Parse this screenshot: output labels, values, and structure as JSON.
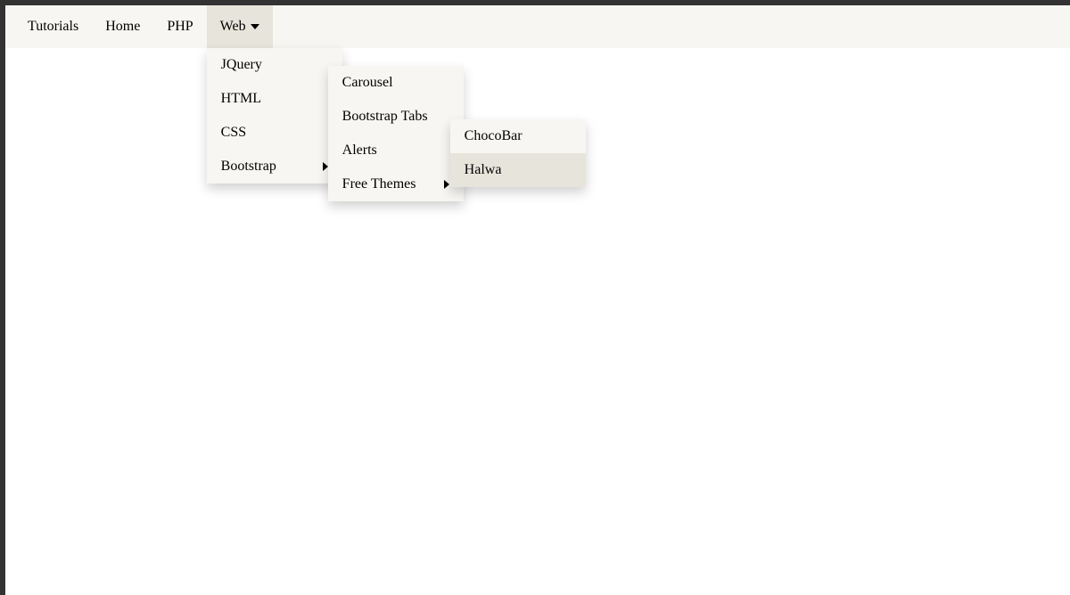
{
  "navbar": {
    "items": [
      {
        "label": "Tutorials"
      },
      {
        "label": "Home"
      },
      {
        "label": "PHP"
      },
      {
        "label": "Web"
      }
    ]
  },
  "dropdown1": {
    "items": [
      {
        "label": "JQuery"
      },
      {
        "label": "HTML"
      },
      {
        "label": "CSS"
      },
      {
        "label": "Bootstrap"
      }
    ]
  },
  "dropdown2": {
    "items": [
      {
        "label": "Carousel"
      },
      {
        "label": "Bootstrap Tabs"
      },
      {
        "label": "Alerts"
      },
      {
        "label": "Free Themes"
      }
    ]
  },
  "dropdown3": {
    "items": [
      {
        "label": "ChocoBar"
      },
      {
        "label": "Halwa"
      }
    ]
  }
}
